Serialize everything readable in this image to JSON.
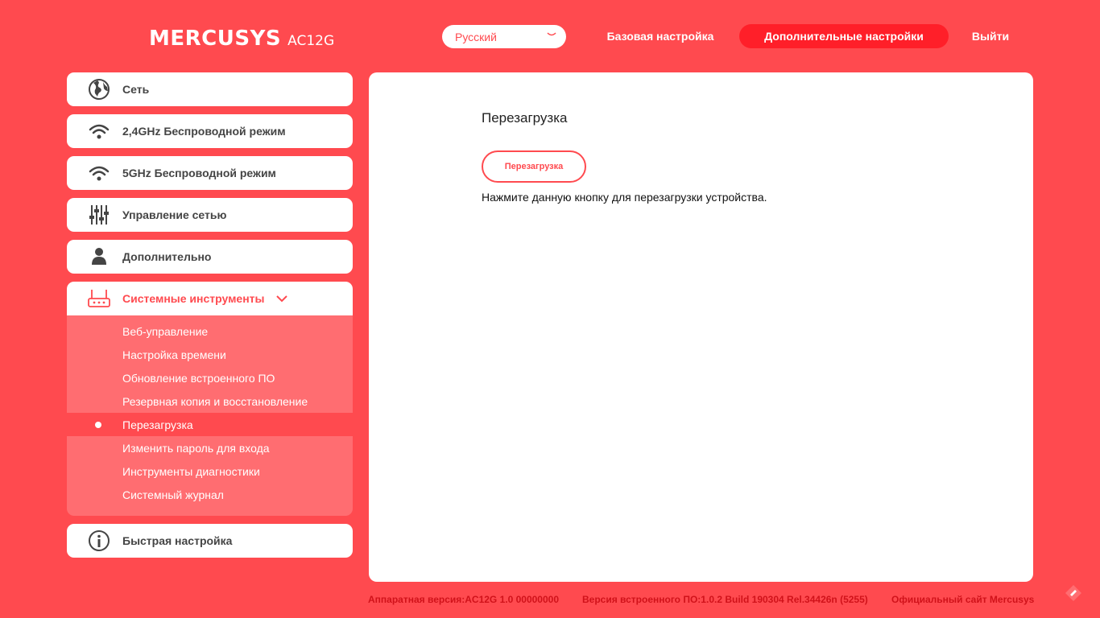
{
  "header": {
    "brand": "MERCUSYS",
    "model": "AC12G",
    "language": "Русский",
    "nav_basic": "Базовая настройка",
    "nav_advanced": "Дополнительные настройки",
    "nav_logout": "Выйти"
  },
  "sidebar": {
    "items": [
      {
        "label": "Сеть",
        "icon": "globe-icon"
      },
      {
        "label": "2,4GHz Беспроводной режим",
        "icon": "wifi-icon"
      },
      {
        "label": "5GHz Беспроводной режим",
        "icon": "wifi-icon"
      },
      {
        "label": "Управление сетью",
        "icon": "sliders-icon"
      },
      {
        "label": "Дополнительно",
        "icon": "user-icon"
      }
    ],
    "system_tools": {
      "label": "Системные инструменты",
      "icon": "router-icon",
      "subitems": [
        "Веб-управление",
        "Настройка времени",
        "Обновление встроенного ПО",
        "Резервная копия и восстановление",
        "Перезагрузка",
        "Изменить пароль для входа",
        "Инструменты диагностики",
        "Системный журнал"
      ],
      "selected_index": 4
    },
    "quick_setup": {
      "label": "Быстрая настройка",
      "icon": "info-icon"
    }
  },
  "main": {
    "title": "Перезагрузка",
    "button_label": "Перезагрузка",
    "description": "Нажмите данную кнопку для перезагрузки устройства."
  },
  "footer": {
    "hardware": "Аппаратная версия:AC12G 1.0 00000000",
    "firmware": "Версия встроенного ПО:1.0.2 Build 190304 Rel.34426n (5255)",
    "official_site": "Официальный сайт Mercusys"
  },
  "colors": {
    "background": "#ff4a4f",
    "accent": "#ff1f29",
    "submenu": "#ff6d71",
    "footer_text": "#d0121a"
  }
}
